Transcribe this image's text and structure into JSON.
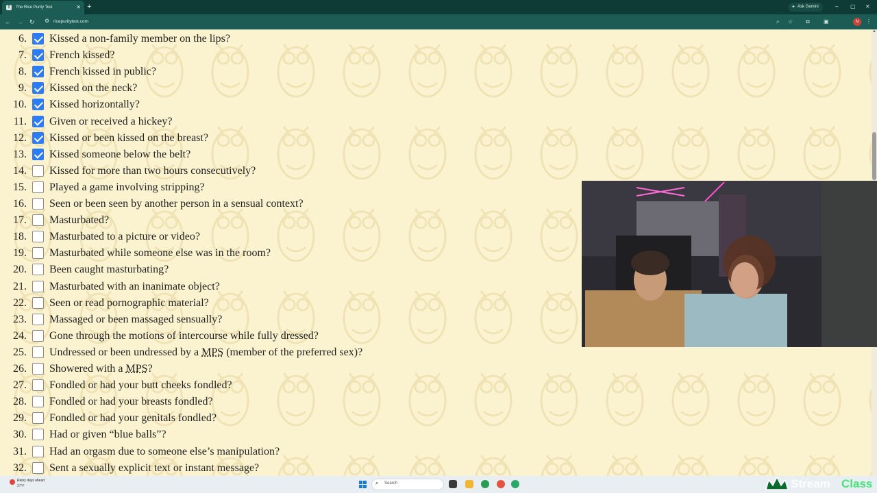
{
  "browser": {
    "tab_title": "The Rice Purity Test",
    "tab_favicon": "T",
    "new_tab": "+",
    "gemini_label": "Ask Gemini",
    "url": "ricepuritytest.com",
    "profile_initial": "N",
    "window_controls": [
      "–",
      "▢",
      "✕"
    ]
  },
  "questions": [
    {
      "num": "6.",
      "text": "Kissed a non-family member on the lips?",
      "checked": true
    },
    {
      "num": "7.",
      "text": "French kissed?",
      "checked": true
    },
    {
      "num": "8.",
      "text": "French kissed in public?",
      "checked": true
    },
    {
      "num": "9.",
      "text": "Kissed on the neck?",
      "checked": true
    },
    {
      "num": "10.",
      "text": "Kissed horizontally?",
      "checked": true
    },
    {
      "num": "11.",
      "text": "Given or received a hickey?",
      "checked": true
    },
    {
      "num": "12.",
      "text": "Kissed or been kissed on the breast?",
      "checked": true
    },
    {
      "num": "13.",
      "text": "Kissed someone below the belt?",
      "checked": true
    },
    {
      "num": "14.",
      "text": "Kissed for more than two hours consecutively?",
      "checked": false
    },
    {
      "num": "15.",
      "text": "Played a game involving stripping?",
      "checked": false
    },
    {
      "num": "16.",
      "text": "Seen or been seen by another person in a sensual context?",
      "checked": false
    },
    {
      "num": "17.",
      "text": "Masturbated?",
      "checked": false
    },
    {
      "num": "18.",
      "text": "Masturbated to a picture or video?",
      "checked": false
    },
    {
      "num": "19.",
      "text": "Masturbated while someone else was in the room?",
      "checked": false
    },
    {
      "num": "20.",
      "text": "Been caught masturbating?",
      "checked": false
    },
    {
      "num": "21.",
      "text": "Masturbated with an inanimate object?",
      "checked": false
    },
    {
      "num": "22.",
      "text": "Seen or read pornographic material?",
      "checked": false
    },
    {
      "num": "23.",
      "text": "Massaged or been massaged sensually?",
      "checked": false
    },
    {
      "num": "24.",
      "text": "Gone through the motions of intercourse while fully dressed?",
      "checked": false
    },
    {
      "num": "25.",
      "text": "Undressed or been undressed by a MPS (member of the preferred sex)?",
      "checked": false
    },
    {
      "num": "26.",
      "text": "Showered with a MPS?",
      "checked": false
    },
    {
      "num": "27.",
      "text": "Fondled or had your butt cheeks fondled?",
      "checked": false
    },
    {
      "num": "28.",
      "text": "Fondled or had your breasts fondled?",
      "checked": false
    },
    {
      "num": "29.",
      "text": "Fondled or had your genitals fondled?",
      "checked": false
    },
    {
      "num": "30.",
      "text": "Had or given “blue balls”?",
      "checked": false
    },
    {
      "num": "31.",
      "text": "Had an orgasm due to someone else’s manipulation?",
      "checked": false
    },
    {
      "num": "32.",
      "text": "Sent a sexually explicit text or instant message?",
      "checked": false
    }
  ],
  "taskbar": {
    "weather_title": "Rainy days ahead",
    "weather_temp": "27°F",
    "search_placeholder": "Search"
  },
  "colors": {
    "page_bg": "#fbf2cf",
    "checkbox_checked": "#2c7cf6",
    "chrome_dark": "#0e3b36",
    "chrome_mid": "#1b5c54"
  }
}
